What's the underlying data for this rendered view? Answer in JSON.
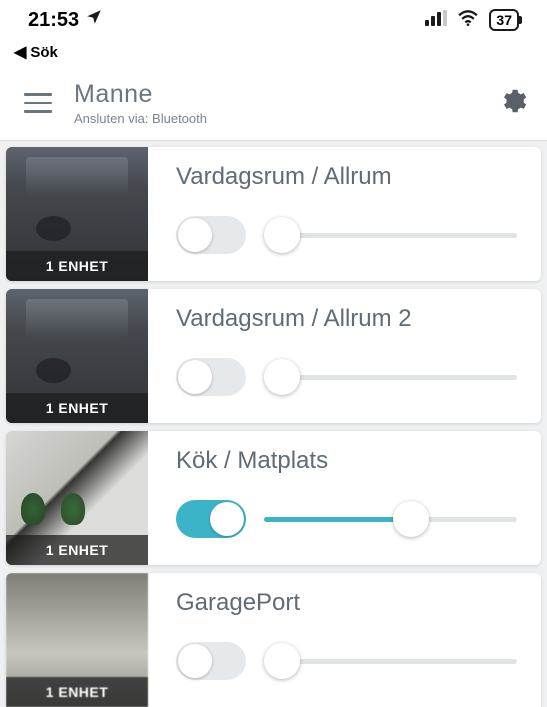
{
  "status": {
    "time": "21:53",
    "back_label": "Sök",
    "battery": "37"
  },
  "header": {
    "title": "Manne",
    "subtitle": "Ansluten via: Bluetooth"
  },
  "rooms": [
    {
      "name": "Vardagsrum / Allrum",
      "unit_label": "1 ENHET",
      "toggle": false,
      "slider": 0,
      "thumb": "living"
    },
    {
      "name": "Vardagsrum / Allrum  2",
      "unit_label": "1 ENHET",
      "toggle": false,
      "slider": 0,
      "thumb": "living"
    },
    {
      "name": "Kök / Matplats",
      "unit_label": "1 ENHET",
      "toggle": true,
      "slider": 58,
      "thumb": "kitchen"
    },
    {
      "name": "GaragePort",
      "unit_label": "1 ENHET",
      "toggle": false,
      "slider": 0,
      "thumb": "garage"
    }
  ],
  "icons": {
    "location": "location-arrow-icon",
    "signal": "cellular-signal-icon",
    "wifi": "wifi-icon",
    "gear": "gear-icon",
    "back": "back-caret-icon"
  }
}
